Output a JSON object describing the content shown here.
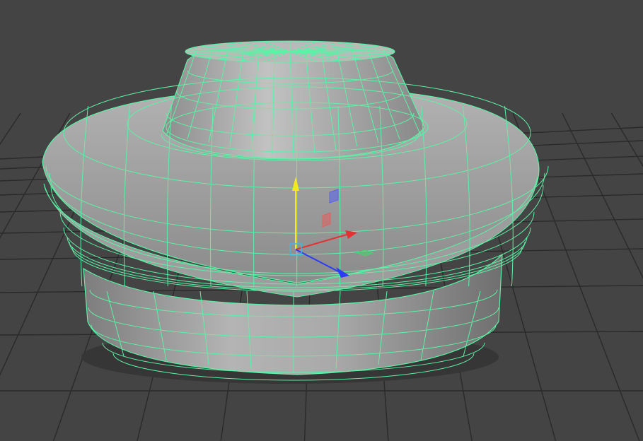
{
  "viewport": {
    "kind": "3d-perspective-viewport",
    "background_color": "#444444",
    "grid_color": "#2a2a2a",
    "wireframe_color": "#5cf2a6",
    "shading_color": "#a8a8a8"
  },
  "mesh": {
    "description_shape": "revolved cap: top dome, wide torus rim, cylindrical base",
    "selected": true,
    "wireframe_on_shaded": true
  },
  "manipulator": {
    "type": "move-tool",
    "axes": [
      {
        "axis": "y",
        "color": "#f7e819",
        "icon": "arrow-up-icon"
      },
      {
        "axis": "x",
        "color": "#e03434",
        "icon": "arrow-right-icon"
      },
      {
        "axis": "z",
        "color": "#2b3cf5",
        "icon": "arrow-diag-icon"
      }
    ],
    "plane_handles": [
      {
        "plane": "xy",
        "color": "#5a66e8"
      },
      {
        "plane": "yz",
        "color": "#e06262"
      },
      {
        "plane": "xz",
        "color": "#44d66a"
      }
    ],
    "center_handle_color": "#3fb7e6"
  }
}
